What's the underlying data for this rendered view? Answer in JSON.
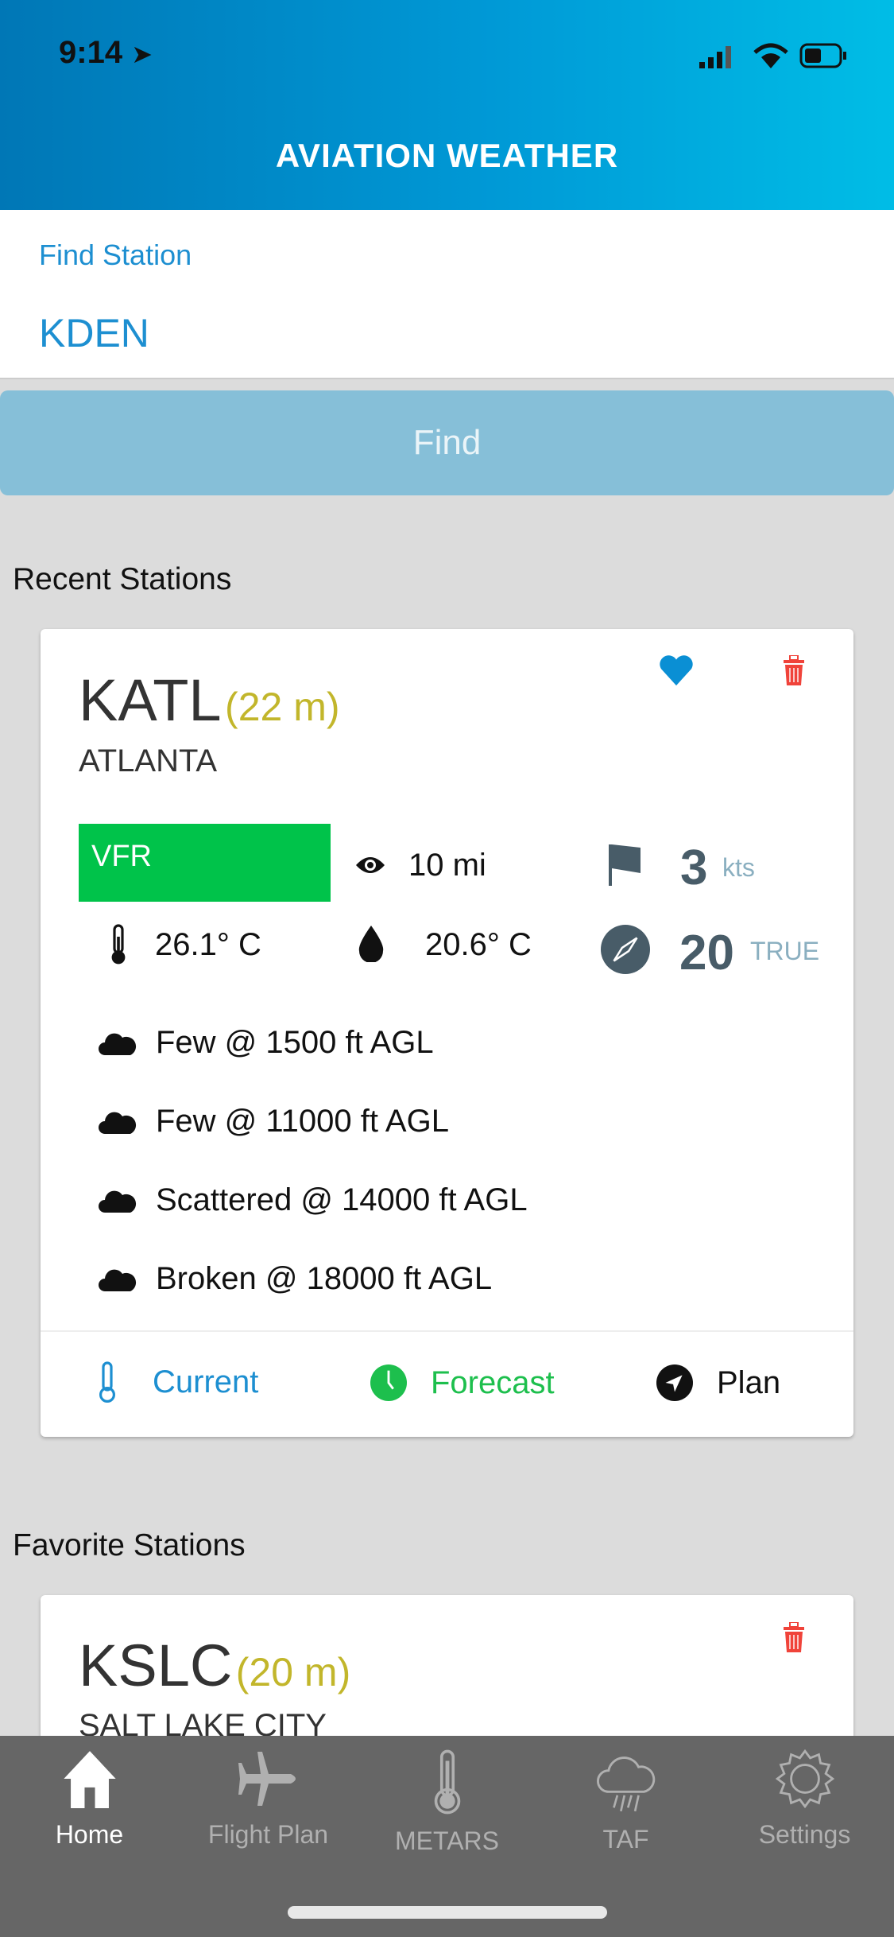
{
  "status_bar": {
    "time": "9:14"
  },
  "header": {
    "title": "AVIATION WEATHER"
  },
  "search": {
    "label": "Find Station",
    "value": "KDEN",
    "button": "Find"
  },
  "recent": {
    "heading": "Recent Stations",
    "station": {
      "code": "KATL",
      "distance": "(22 m)",
      "city": "ATLANTA",
      "flight_category": "VFR",
      "flight_category_color": "#00c34a",
      "visibility": "10 mi",
      "wind_speed": "3",
      "wind_unit": "kts",
      "temperature": "26.1° C",
      "dewpoint": "20.6° C",
      "wind_direction": "20",
      "wind_ref": "TRUE",
      "favorite": true,
      "clouds": [
        "Few @ 1500 ft AGL",
        "Few @ 11000 ft AGL",
        "Scattered @ 14000 ft AGL",
        "Broken @ 18000 ft AGL"
      ],
      "actions": {
        "current": "Current",
        "forecast": "Forecast",
        "plan": "Plan"
      }
    }
  },
  "favorites": {
    "heading": "Favorite Stations",
    "station": {
      "code": "KSLC",
      "distance": "(20 m)",
      "city": "SALT LAKE CITY"
    }
  },
  "tabs": [
    {
      "label": "Home",
      "icon": "home-icon"
    },
    {
      "label": "Flight Plan",
      "icon": "airplane-icon"
    },
    {
      "label": "METARS",
      "icon": "thermometer-icon"
    },
    {
      "label": "TAF",
      "icon": "rain-cloud-icon"
    },
    {
      "label": "Settings",
      "icon": "gear-icon"
    }
  ],
  "colors": {
    "accent": "#1d8fd1",
    "distance": "#c2b62b",
    "delete": "#f0433a",
    "forecast": "#1dbf4d"
  }
}
